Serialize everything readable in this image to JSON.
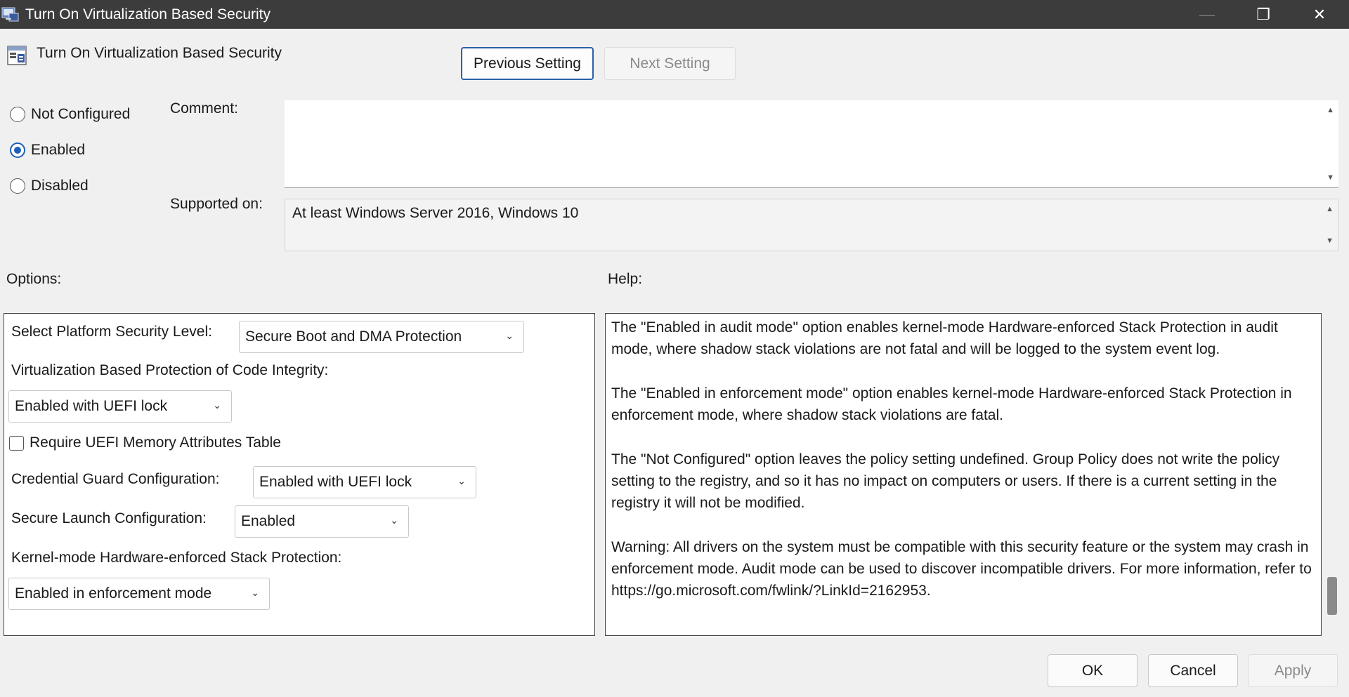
{
  "window": {
    "title": "Turn On Virtualization Based Security",
    "minimize_glyph": "—",
    "maximize_glyph": "❐",
    "close_glyph": "✕"
  },
  "header": {
    "policy_title": "Turn On Virtualization Based Security",
    "previous_label": "Previous Setting",
    "next_label": "Next Setting"
  },
  "state": {
    "options": [
      "Not Configured",
      "Enabled",
      "Disabled"
    ],
    "selected": "Enabled"
  },
  "comment": {
    "label": "Comment:",
    "value": ""
  },
  "supported": {
    "label": "Supported on:",
    "value": "At least Windows Server 2016, Windows 10"
  },
  "options_panel": {
    "heading": "Options:",
    "platform_label": "Select Platform Security Level:",
    "platform_value": "Secure Boot and DMA Protection",
    "vbs_ci_label": "Virtualization Based Protection of Code Integrity:",
    "vbs_ci_value": "Enabled with UEFI lock",
    "uefi_mat_label": "Require UEFI Memory Attributes Table",
    "uefi_mat_checked": false,
    "cred_guard_label": "Credential Guard Configuration:",
    "cred_guard_value": "Enabled with UEFI lock",
    "secure_launch_label": "Secure Launch Configuration:",
    "secure_launch_value": "Enabled",
    "stack_prot_label": "Kernel-mode Hardware-enforced Stack Protection:",
    "stack_prot_value": "Enabled in enforcement mode"
  },
  "help_panel": {
    "heading": "Help:",
    "paragraphs": [
      "The \"Enabled in audit mode\" option enables kernel-mode Hardware-enforced Stack Protection in audit mode, where shadow stack violations are not fatal and will be logged to the system event log.",
      "The \"Enabled in enforcement mode\" option enables kernel-mode Hardware-enforced Stack Protection in enforcement mode, where shadow stack violations are fatal.",
      "The \"Not Configured\" option leaves the policy setting undefined. Group Policy does not write the policy setting to the registry, and so it has no impact on computers or users. If there is a current setting in the registry it will not be modified.",
      "Warning: All drivers on the system must be compatible with this security feature or the system may crash in enforcement mode. Audit mode can be used to discover incompatible drivers. For more information, refer to https://go.microsoft.com/fwlink/?LinkId=2162953."
    ]
  },
  "footer": {
    "ok_label": "OK",
    "cancel_label": "Cancel",
    "apply_label": "Apply"
  },
  "colors": {
    "titlebar": "#3c3c3c",
    "accent": "#1f5fb8",
    "window_bg": "#f0f0f0"
  }
}
